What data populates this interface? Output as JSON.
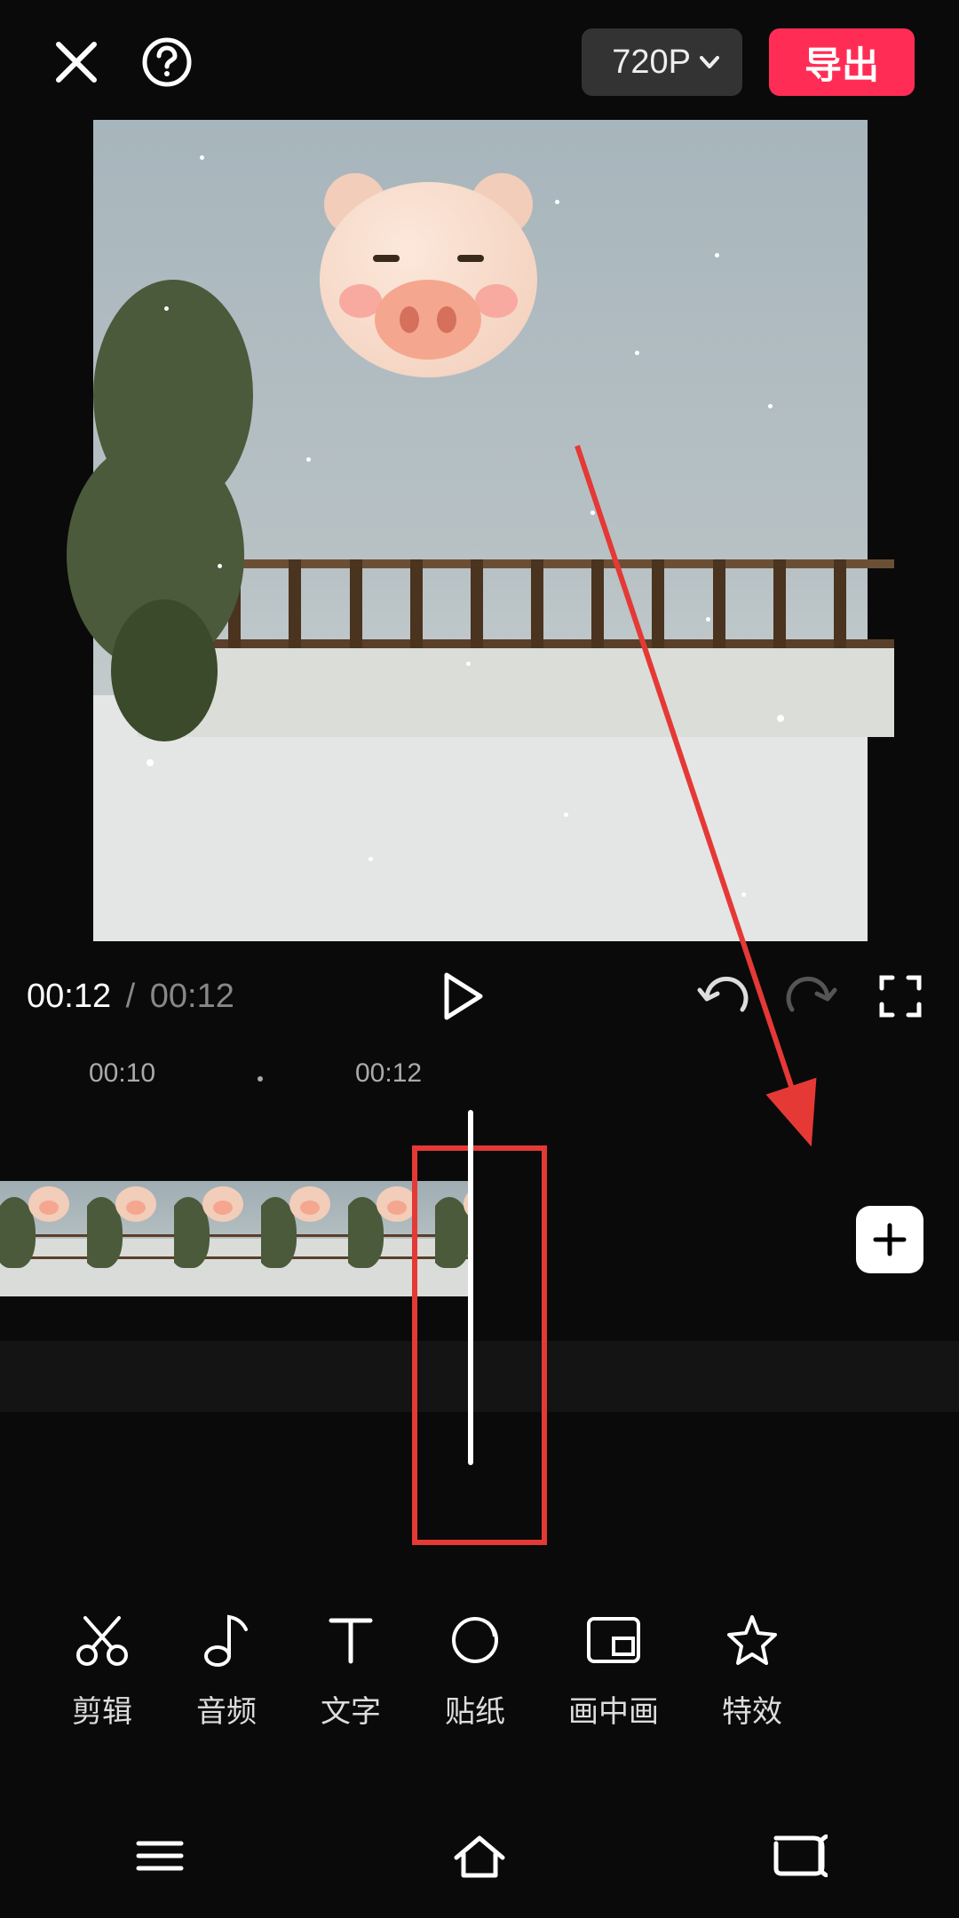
{
  "header": {
    "resolution_label": "720P",
    "export_label": "导出"
  },
  "playback": {
    "current_time": "00:12",
    "separator": "/",
    "duration": "00:12"
  },
  "timeline": {
    "ruler_labels": [
      "00:10",
      "00:12"
    ],
    "annotation": {
      "arrow_color": "#e53935",
      "highlight_box_color": "#e53935"
    }
  },
  "tools": [
    {
      "id": "cut",
      "icon": "scissors-icon",
      "label": "剪辑"
    },
    {
      "id": "audio",
      "icon": "music-note-icon",
      "label": "音频"
    },
    {
      "id": "text",
      "icon": "text-icon",
      "label": "文字"
    },
    {
      "id": "sticker",
      "icon": "sticker-icon",
      "label": "贴纸"
    },
    {
      "id": "pip",
      "icon": "pip-icon",
      "label": "画中画"
    },
    {
      "id": "effect",
      "icon": "star-icon",
      "label": "特效"
    }
  ],
  "icons": {
    "close": "close-icon",
    "help": "help-icon",
    "play": "play-icon",
    "undo": "undo-icon",
    "redo": "redo-icon",
    "fullscreen": "fullscreen-icon",
    "add": "plus-icon",
    "chevron_down": "chevron-down-icon",
    "nav_menu": "menu-icon",
    "nav_home": "home-icon",
    "nav_back": "back-icon"
  },
  "colors": {
    "accent": "#ff2d55",
    "button_gray": "#333333",
    "disabled": "#555555"
  }
}
